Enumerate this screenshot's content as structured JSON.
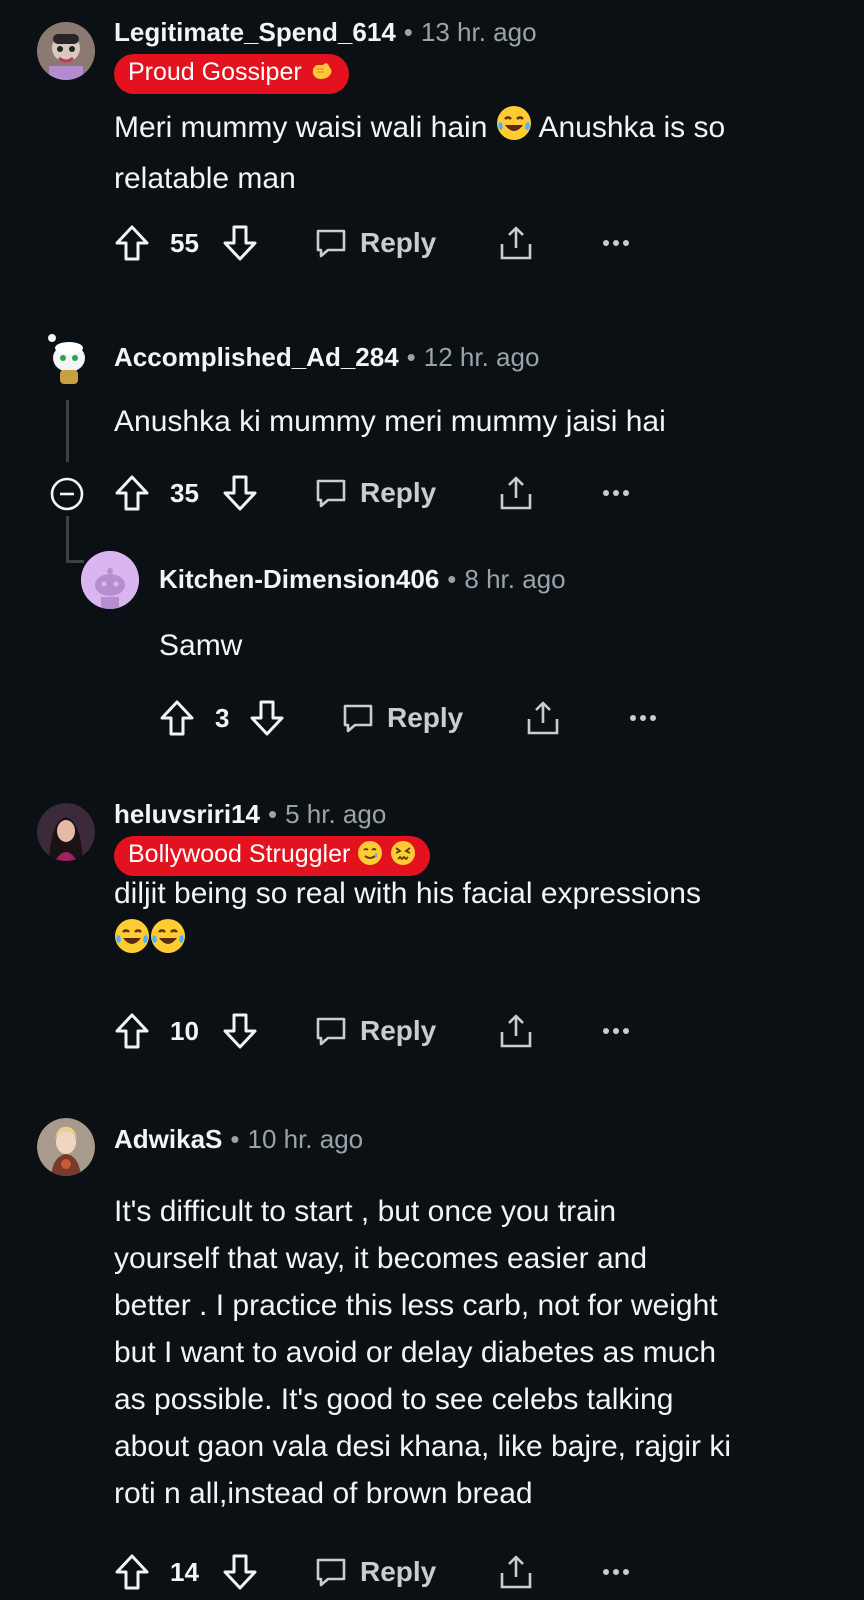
{
  "comments": [
    {
      "username": "Legitimate_Spend_614",
      "time": "13 hr. ago",
      "flair": "Proud Gossiper",
      "text": "Meri mummy waisi wali hain",
      "text_after_emoji": "Anushka is so",
      "text_line2": "relatable man",
      "votes": "55",
      "reply_label": "Reply"
    },
    {
      "username": "Accomplished_Ad_284",
      "time": "12 hr. ago",
      "text": "Anushka ki mummy meri mummy jaisi hai",
      "votes": "35",
      "reply_label": "Reply"
    },
    {
      "username": "Kitchen-Dimension406",
      "time": "8 hr. ago",
      "text": "Samw",
      "votes": "3",
      "reply_label": "Reply"
    },
    {
      "username": "heluvsriri14",
      "time": "5 hr. ago",
      "flair": "Bollywood Struggler",
      "text": "diljit being so real with his facial expressions",
      "votes": "10",
      "reply_label": "Reply"
    },
    {
      "username": "AdwikaS",
      "time": "10 hr. ago",
      "text_lines": [
        "It's difficult to start , but once you train",
        "yourself that way, it becomes easier and",
        "better . I practice this less carb, not for weight",
        "but I want to avoid or delay diabetes as much",
        "as possible. It's good to see celebs talking",
        "about gaon vala desi khana, like bajre, rajgir ki",
        "roti n all,instead of brown bread"
      ],
      "votes": "14",
      "reply_label": "Reply"
    }
  ],
  "icons": {
    "upvote": "upvote-arrow-icon",
    "downvote": "downvote-arrow-icon",
    "reply": "speech-bubble-icon",
    "share": "share-icon",
    "more": "more-dots-icon",
    "collapse": "collapse-minus-icon"
  },
  "colors": {
    "background": "#0b1014",
    "flair_red": "#e3121e",
    "muted": "#9aa3a8"
  }
}
